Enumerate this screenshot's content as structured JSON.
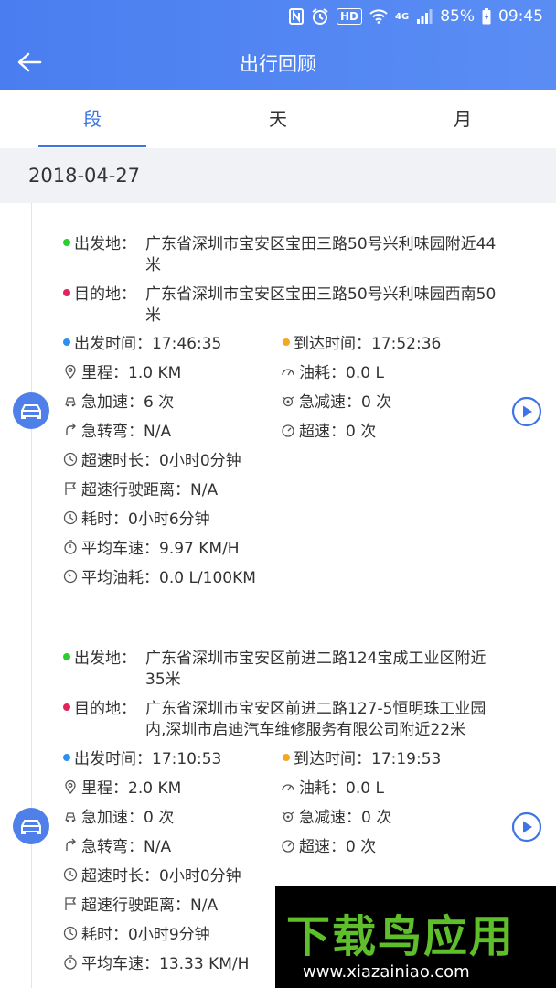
{
  "status_bar": {
    "icons": [
      "nfc-icon",
      "alarm-icon",
      "hd-badge",
      "wifi-icon",
      "4g-badge",
      "signal-icon",
      "battery-icon"
    ],
    "hd": "HD",
    "network": "4G",
    "battery": "85%",
    "time": "09:45"
  },
  "header": {
    "title": "出行回顾",
    "back_icon": "back-arrow-icon"
  },
  "tabs": [
    {
      "label": "段",
      "active": true
    },
    {
      "label": "天",
      "active": false
    },
    {
      "label": "月",
      "active": false
    }
  ],
  "date": "2018-04-27",
  "colors": {
    "header": "#4a7ef0",
    "accent": "#3f74e6",
    "start_dot": "#2ecc2e",
    "end_dot": "#e0245e",
    "depart_dot": "#2d8ff0",
    "arrive_dot": "#f5a623",
    "car_badge": "#4f7fe8"
  },
  "trips": [
    {
      "origin_label": "出发地：",
      "origin": "广东省深圳市宝安区宝田三路50号兴利味园附近44米",
      "dest_label": "目的地：",
      "dest": "广东省深圳市宝安区宝田三路50号兴利味园西南50米",
      "depart": "出发时间：17:46:35",
      "arrive": "到达时间：17:52:36",
      "mileage": "里程：1.0 KM",
      "fuel": "油耗：0.0 L",
      "hard_accel": "急加速：6 次",
      "hard_brake": "急减速：0 次",
      "sharp_turn": "急转弯：N/A",
      "overspeed": "超速：0 次",
      "overspeed_duration": "超速时长：0小时0分钟",
      "overspeed_distance": "超速行驶距离：N/A",
      "duration": "耗时：0小时6分钟",
      "avg_speed": "平均车速：9.97 KM/H",
      "avg_fuel": "平均油耗：0.0 L/100KM"
    },
    {
      "origin_label": "出发地：",
      "origin": "广东省深圳市宝安区前进二路124宝成工业区附近35米",
      "dest_label": "目的地：",
      "dest": "广东省深圳市宝安区前进二路127-5恒明珠工业园内,深圳市启迪汽车维修服务有限公司附近22米",
      "depart": "出发时间：17:10:53",
      "arrive": "到达时间：17:19:53",
      "mileage": "里程：2.0 KM",
      "fuel": "油耗：0.0 L",
      "hard_accel": "急加速：0 次",
      "hard_brake": "急减速：0 次",
      "sharp_turn": "急转弯：N/A",
      "overspeed": "超速：0 次",
      "overspeed_duration": "超速时长：0小时0分钟",
      "overspeed_distance": "超速行驶距离：N/A",
      "duration": "耗时：0小时9分钟",
      "avg_speed": "平均车速：13.33 KM/H"
    }
  ],
  "watermark": {
    "brand": "下载鸟应用",
    "url": "www.xiazainiao.com"
  }
}
